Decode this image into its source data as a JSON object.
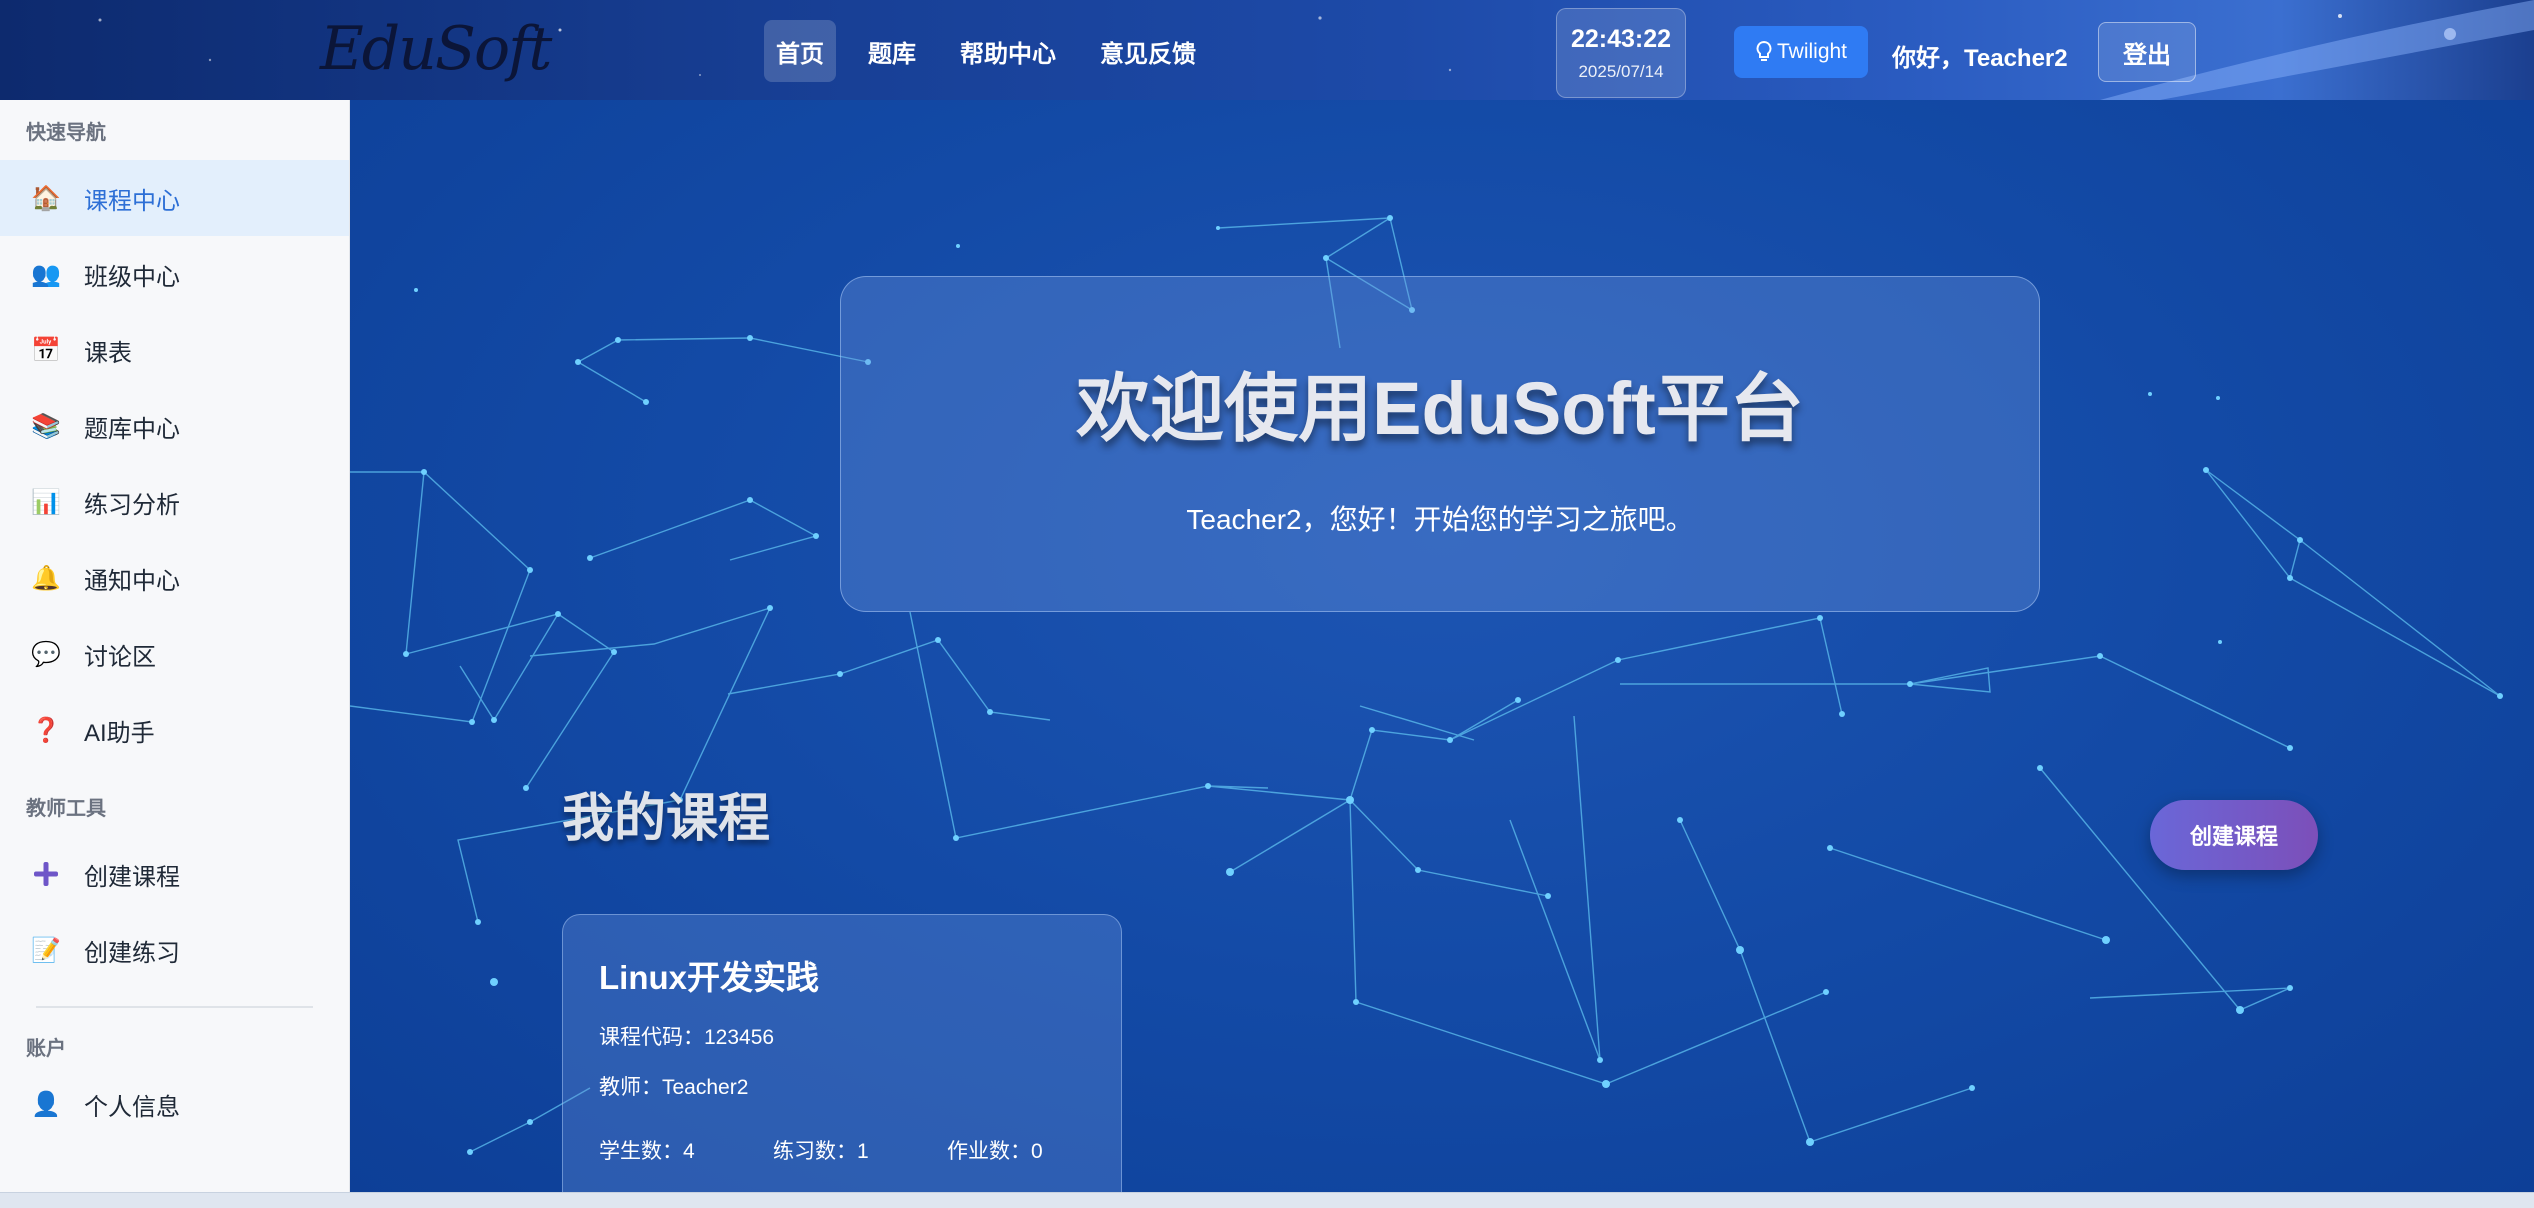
{
  "header": {
    "logo": "EduSoft",
    "nav": [
      {
        "label": "首页",
        "active": true
      },
      {
        "label": "题库",
        "active": false
      },
      {
        "label": "帮助中心",
        "active": false
      },
      {
        "label": "意见反馈",
        "active": false
      }
    ],
    "clock": {
      "time": "22:43:22",
      "date": "2025/07/14"
    },
    "theme_button": "Twilight",
    "greeting": "你好，Teacher2",
    "logout": "登出"
  },
  "sidebar": {
    "sections": [
      {
        "title": "快速导航",
        "items": [
          {
            "label": "课程中心",
            "icon": "home-icon",
            "glyph": "🏠",
            "active": true
          },
          {
            "label": "班级中心",
            "icon": "people-icon",
            "glyph": "👥",
            "active": false
          },
          {
            "label": "课表",
            "icon": "calendar-icon",
            "glyph": "📅",
            "active": false
          },
          {
            "label": "题库中心",
            "icon": "books-icon",
            "glyph": "📚",
            "active": false
          },
          {
            "label": "练习分析",
            "icon": "bar-chart-icon",
            "glyph": "📊",
            "active": false
          },
          {
            "label": "通知中心",
            "icon": "bell-icon",
            "glyph": "🔔",
            "active": false
          },
          {
            "label": "讨论区",
            "icon": "speech-bubble-icon",
            "glyph": "💬",
            "active": false
          },
          {
            "label": "AI助手",
            "icon": "question-mark-icon",
            "glyph": "❓",
            "active": false
          }
        ]
      },
      {
        "title": "教师工具",
        "items": [
          {
            "label": "创建课程",
            "icon": "plus-icon",
            "glyph": "➕",
            "active": false
          },
          {
            "label": "创建练习",
            "icon": "memo-icon",
            "glyph": "📝",
            "active": false
          }
        ]
      },
      {
        "title": "账户",
        "items": [
          {
            "label": "个人信息",
            "icon": "user-icon",
            "glyph": "👤",
            "active": false
          }
        ]
      }
    ]
  },
  "main": {
    "hero_title": "欢迎使用EduSoft平台",
    "hero_subtitle": "Teacher2，您好！开始您的学习之旅吧。",
    "section_title": "我的课程",
    "create_course_button": "创建课程",
    "course": {
      "name": "Linux开发实践",
      "code": "课程代码：123456",
      "teacher": "教师：Teacher2",
      "students": "学生数：4",
      "exercises": "练习数：1",
      "assignments": "作业数：0"
    }
  },
  "colors": {
    "accent": "#2f7bf3",
    "main_bg": "#134aa6",
    "active_nav_text": "#2d6fd6",
    "create_btn": "#6a67d8"
  }
}
